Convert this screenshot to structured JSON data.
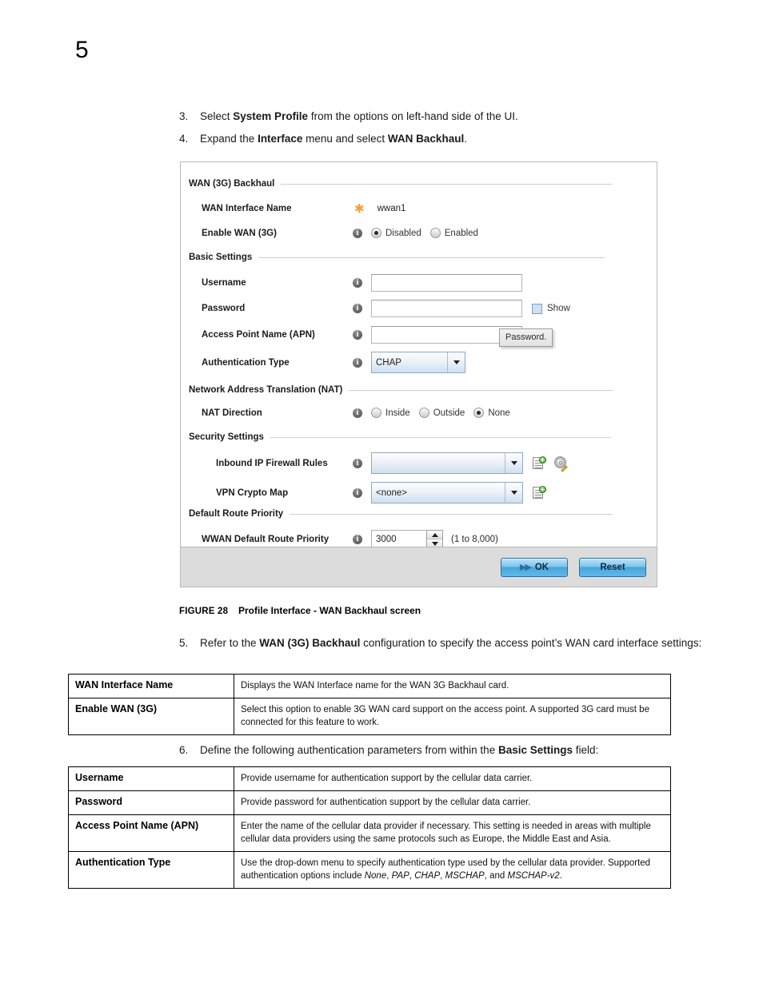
{
  "page": {
    "chapter_number": "5"
  },
  "steps": {
    "step3": {
      "num": "3.",
      "text_parts": [
        "Select ",
        "System Profile",
        " from the options on left-hand side of the UI."
      ]
    },
    "step4": {
      "num": "4.",
      "text_parts": [
        "Expand the ",
        "Interface",
        " menu and select ",
        "WAN Backhaul",
        "."
      ]
    },
    "step5": {
      "num": "5.",
      "text_parts": [
        "Refer to the ",
        "WAN (3G) Backhaul",
        " configuration to specify the access point’s WAN card interface settings:"
      ]
    },
    "step6": {
      "num": "6.",
      "text_parts": [
        "Define the following authentication parameters from within the ",
        "Basic Settings",
        " field:"
      ]
    }
  },
  "dialog": {
    "sections": {
      "wan_backhaul": "WAN (3G) Backhaul",
      "basic_settings": "Basic Settings",
      "nat": "Network Address Translation (NAT)",
      "security_settings": "Security Settings",
      "default_route_priority": "Default Route Priority"
    },
    "wan_interface_name": {
      "label": "WAN Interface Name",
      "value": "wwan1",
      "required_marker": "✱"
    },
    "enable_wan": {
      "label": "Enable WAN (3G)",
      "options": [
        {
          "label": "Disabled",
          "selected": true
        },
        {
          "label": "Enabled",
          "selected": false
        }
      ]
    },
    "username": {
      "label": "Username",
      "value": "",
      "placeholder": ""
    },
    "password": {
      "label": "Password",
      "value": "",
      "placeholder": "",
      "show_label": "Show",
      "show_checked": false
    },
    "apn": {
      "label": "Access Point Name (APN)",
      "value": "",
      "placeholder": ""
    },
    "tooltip": {
      "text": "Password."
    },
    "auth_type": {
      "label": "Authentication Type",
      "value": "CHAP",
      "options": [
        "None",
        "PAP",
        "CHAP",
        "MSCHAP",
        "MSCHAP-v2"
      ]
    },
    "nat_direction": {
      "label": "NAT Direction",
      "options": [
        {
          "label": "Inside",
          "selected": false
        },
        {
          "label": "Outside",
          "selected": false
        },
        {
          "label": "None",
          "selected": true
        }
      ]
    },
    "inbound_firewall": {
      "label": "Inbound IP Firewall Rules",
      "value": ""
    },
    "vpn_crypto_map": {
      "label": "VPN Crypto Map",
      "value": "<none>"
    },
    "wwan_priority": {
      "label": "WWAN Default Route Priority",
      "value": "3000",
      "range_hint": "(1 to 8,000)"
    },
    "buttons": {
      "ok": "OK",
      "reset": "Reset"
    }
  },
  "figure": {
    "number": "FIGURE 28",
    "title": "Profile Interface - WAN Backhaul screen"
  },
  "table1": {
    "rows": [
      {
        "key": "WAN Interface Name",
        "value": "Displays the WAN Interface name for the WAN 3G Backhaul card."
      },
      {
        "key": "Enable WAN (3G)",
        "value": "Select this option to enable 3G WAN card support on the access point. A supported 3G card must be connected for this feature to work."
      }
    ]
  },
  "table2": {
    "rows": [
      {
        "key": "Username",
        "value": "Provide username for authentication support by the cellular data carrier."
      },
      {
        "key": "Password",
        "value": "Provide password for authentication support by the cellular data carrier."
      },
      {
        "key": "Access Point Name (APN)",
        "value": "Enter the name of the cellular data provider if necessary. This setting is needed in areas with multiple cellular data providers using the same protocols such as Europe, the Middle East and Asia."
      },
      {
        "key": "Authentication Type",
        "value_pre": "Use the drop-down menu to specify authentication type used by the cellular data provider. Supported authentication options include ",
        "value_italics": [
          "None",
          "PAP",
          "CHAP",
          "MSCHAP",
          "MSCHAP-v2"
        ],
        "value_joiner": ", ",
        "value_last_joiner": ", and ",
        "value_post": "."
      }
    ]
  }
}
